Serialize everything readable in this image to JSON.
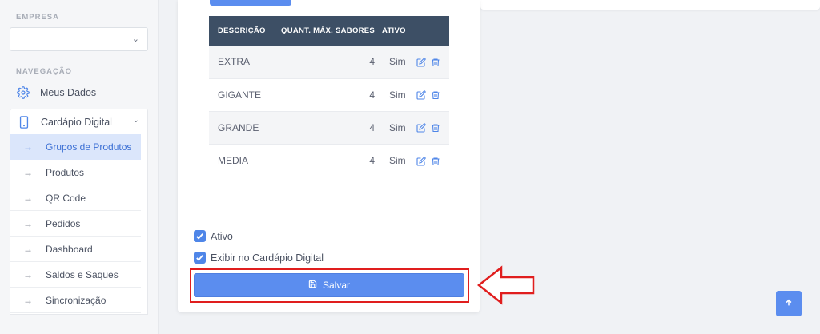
{
  "sidebar": {
    "empresa_label": "EMPRESA",
    "empresa_select_value": "",
    "navegacao_label": "NAVEGAÇÃO",
    "meus_dados": "Meus Dados",
    "cardapio": "Cardápio Digital",
    "submenu": [
      {
        "label": "Grupos de Produtos",
        "active": true
      },
      {
        "label": "Produtos"
      },
      {
        "label": "QR Code"
      },
      {
        "label": "Pedidos"
      },
      {
        "label": "Dashboard"
      },
      {
        "label": "Saldos e Saques"
      },
      {
        "label": "Sincronização"
      }
    ]
  },
  "table": {
    "headers": [
      "DESCRIÇÃO",
      "QUANT. MÁX. SABORES",
      "ATIVO"
    ],
    "rows": [
      {
        "descricao": "EXTRA",
        "quant": "4",
        "ativo": "Sim"
      },
      {
        "descricao": "GIGANTE",
        "quant": "4",
        "ativo": "Sim"
      },
      {
        "descricao": "GRANDE",
        "quant": "4",
        "ativo": "Sim"
      },
      {
        "descricao": "MEDIA",
        "quant": "4",
        "ativo": "Sim"
      }
    ]
  },
  "form": {
    "ativo_label": "Ativo",
    "ativo_checked": true,
    "exibir_label": "Exibir no Cardápio Digital",
    "exibir_checked": true,
    "save_label": "Salvar"
  },
  "icons": {
    "settings": "gear-icon",
    "cardapio": "phone-icon",
    "edit": "edit-icon",
    "delete": "trash-icon",
    "save": "floppy-disk-icon",
    "scroll_top": "arrow-up-icon"
  },
  "colors": {
    "accent": "#5b8def",
    "table_header": "#3d4f65",
    "highlight": "#e01e1e"
  }
}
